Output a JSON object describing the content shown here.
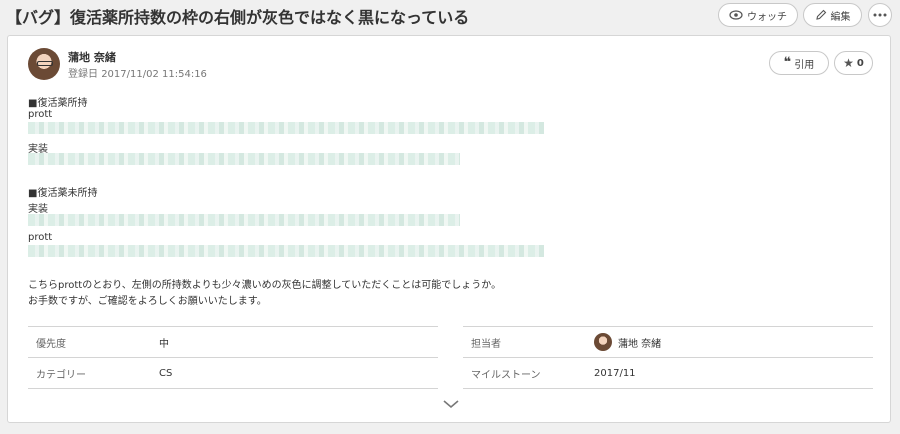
{
  "issue": {
    "title": "【バグ】復活薬所持数の枠の右側が灰色ではなく黒になっている"
  },
  "header_actions": {
    "watch_label": "ウォッチ",
    "edit_label": "編集"
  },
  "comment": {
    "author": "蒲地 奈緒",
    "date_label": "登録日",
    "date": "2017/11/02 11:54:16",
    "quote_label": "引用",
    "star_count": "0",
    "lines": {
      "section1": "■復活薬所持",
      "prott1": "prott",
      "impl1": "実装",
      "section2": "■復活薬未所持",
      "impl2": "実装",
      "prott2": "prott",
      "request1": "こちらprottのとおり、左側の所持数よりも少々濃いめの灰色に調整していただくことは可能でしょうか。",
      "request2": "お手数ですが、ご確認をよろしくお願いいたします。"
    }
  },
  "properties": {
    "priority_label": "優先度",
    "priority_value": "中",
    "category_label": "カテゴリー",
    "category_value": "CS",
    "assignee_label": "担当者",
    "assignee_value": "蒲地 奈緒",
    "milestone_label": "マイルストーン",
    "milestone_value": "2017/11"
  },
  "colors": {
    "accent_blur": "#d8ece4",
    "border": "#d4d4d4"
  }
}
